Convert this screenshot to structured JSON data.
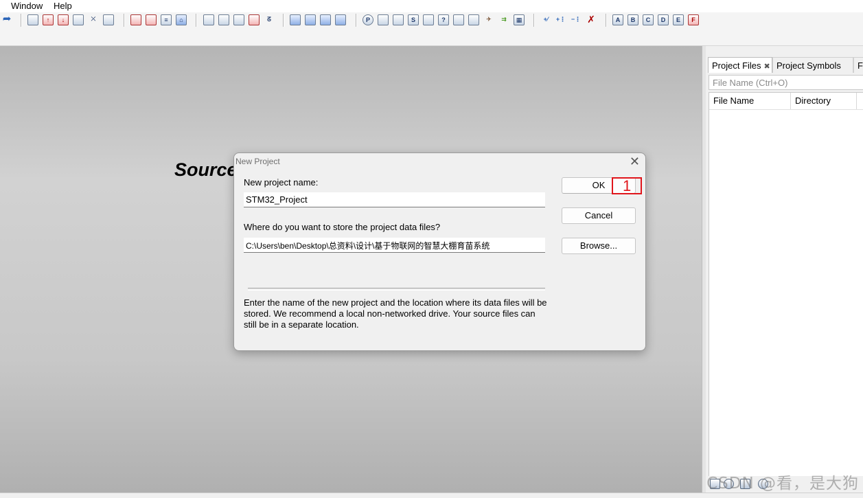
{
  "menu": {
    "window": "Window",
    "help": "Help"
  },
  "toolbar": {
    "icons": [
      "redo-icon",
      "new-file-icon",
      "open-file-icon",
      "save-icon",
      "save-all-icon",
      "find-icon",
      "browse-icon",
      "bookmark-prev-icon",
      "bookmark-next-icon",
      "indent-icon",
      "outdent-icon",
      "project-icon",
      "symbol-icon",
      "book-icon",
      "jump-icon",
      "relation-icon",
      "window-tile-icon",
      "window-horiz-icon",
      "window-vert-icon",
      "window-cascade-icon",
      "project-window-icon",
      "browse-window-icon",
      "relation-window-icon",
      "symbol-window-icon",
      "lookup-icon",
      "context-icon",
      "clip-window-icon",
      "overview-icon",
      "sync-icon",
      "build-icon",
      "layout-icon",
      "zoom-in-icon",
      "zoom-add-icon",
      "zoom-remove-icon",
      "zoom-close-icon",
      "a-icon",
      "b-icon",
      "c-icon",
      "d-icon",
      "e-icon",
      "f-icon"
    ]
  },
  "editor": {
    "source_label": "Source"
  },
  "right_panel": {
    "tabs": [
      {
        "label": "Project Files",
        "close": "✖"
      },
      {
        "label": "Project Symbols"
      },
      {
        "label": "Fc"
      }
    ],
    "search_placeholder": "File Name (Ctrl+O)",
    "columns": [
      "File Name",
      "Directory"
    ]
  },
  "dialog": {
    "title": "New Project",
    "close": "✕",
    "name_label": "New project name:",
    "name_value": "STM32_Project",
    "location_label": "Where do you want to store the project data files?",
    "location_value": "C:\\Users\\ben\\Desktop\\总资料\\设计\\基于物联网的智慧大棚育苗系统",
    "ok_label": "OK",
    "cancel_label": "Cancel",
    "browse_label": "Browse...",
    "hint": "Enter the name of the new project and the location where its data files will be stored. We recommend a local non-networked drive. Your source files can still be in a separate location.",
    "annotation": "1"
  },
  "watermark": "CSDN @看，是大狗",
  "colors": {
    "annotation": "#e0151b",
    "background": "#c8c8c8"
  }
}
